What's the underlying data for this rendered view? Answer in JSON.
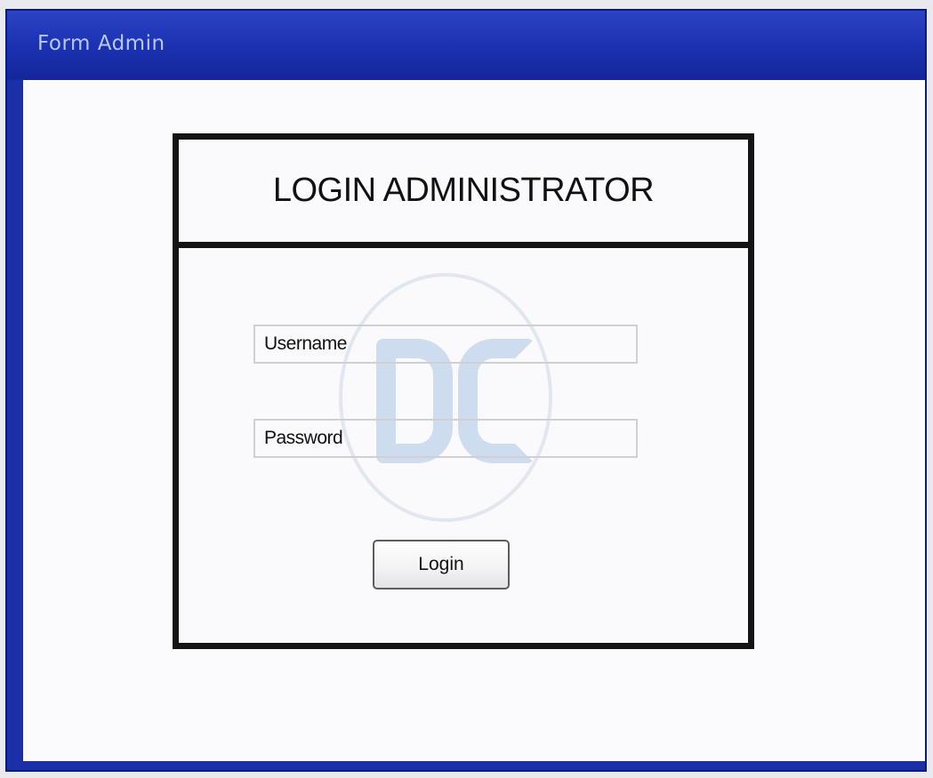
{
  "window": {
    "title": "Form Admin"
  },
  "login_panel": {
    "heading": "LOGIN ADMINISTRATOR",
    "username_field": {
      "value": "Username"
    },
    "password_field": {
      "value": "Password"
    },
    "login_button_label": "Login"
  },
  "colors": {
    "titlebar": "#1a30b0",
    "title_text": "#b9c6ff",
    "client_background": "#fbfbfd",
    "panel_border": "#141414"
  }
}
